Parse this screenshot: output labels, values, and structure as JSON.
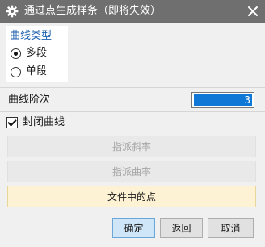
{
  "titlebar": {
    "title": "通过点生成样条（即将失效）",
    "icon": "gear-icon",
    "close_icon": "close-icon",
    "background": "#6f6f6f"
  },
  "curve_type": {
    "heading": "曲线类型",
    "options": [
      {
        "label": "多段",
        "selected": true
      },
      {
        "label": "单段",
        "selected": false
      }
    ]
  },
  "curve_degree": {
    "label": "曲线阶次",
    "value": "3"
  },
  "closed_curve": {
    "label": "封闭曲线",
    "checked": true
  },
  "actions": {
    "assign_slope": "指派斜率",
    "assign_curvature": "指派曲率",
    "points_from_file": "文件中的点"
  },
  "footer": {
    "ok": "确定",
    "back": "返回",
    "cancel": "取消"
  },
  "colors": {
    "accent_blue": "#1d5fae",
    "selection_blue": "#0f78d7",
    "highlight_yellow": "#fdf3d4"
  }
}
